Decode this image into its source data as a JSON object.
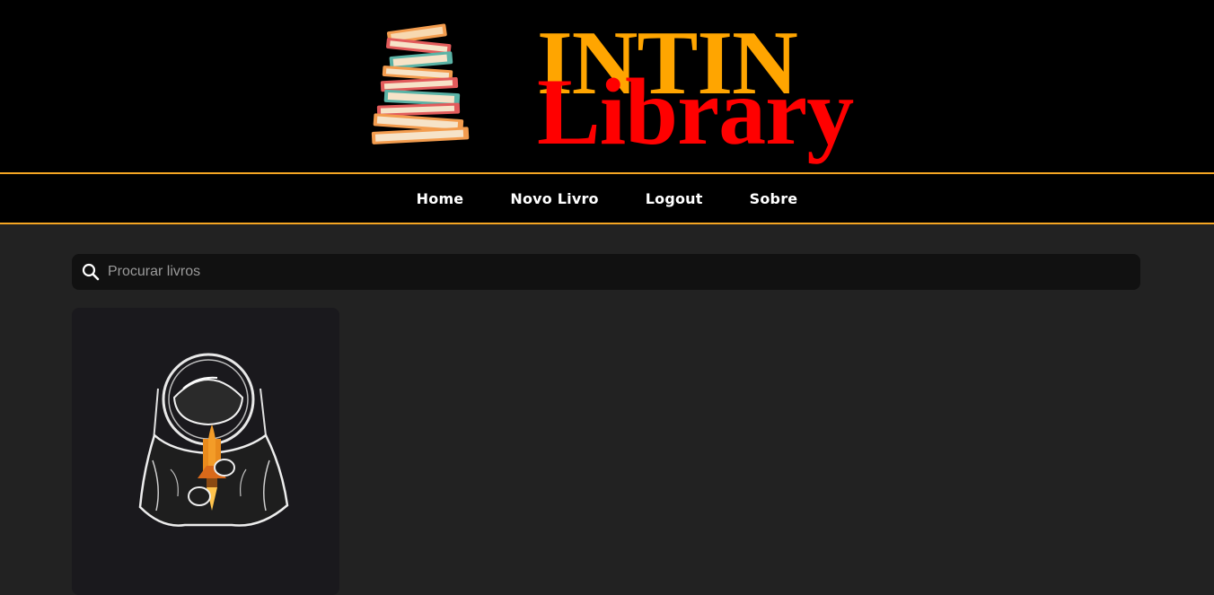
{
  "header": {
    "logo_icon": "book-stack-icon",
    "brand_line1": "INTIN",
    "brand_line2": "Library",
    "colors": {
      "brand_primary": "#FFA500",
      "brand_secondary": "#FF0000",
      "nav_border": "#F5A623"
    }
  },
  "nav": {
    "items": [
      {
        "label": "Home"
      },
      {
        "label": "Novo Livro"
      },
      {
        "label": "Logout"
      },
      {
        "label": "Sobre"
      }
    ]
  },
  "search": {
    "icon": "search-icon",
    "placeholder": "Procurar livros",
    "value": ""
  },
  "books": [
    {
      "cover_icon": "astronaut-holding-rocket-illustration"
    }
  ]
}
